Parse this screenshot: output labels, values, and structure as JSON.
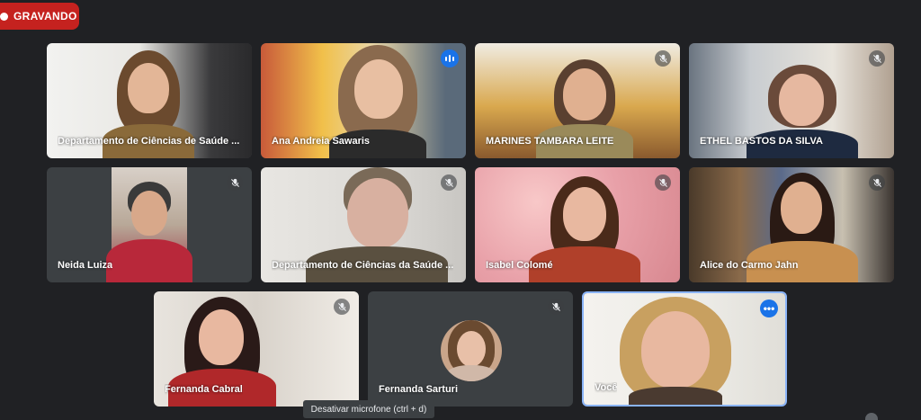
{
  "recording": {
    "label": "GRAVANDO",
    "color": "#c5221f"
  },
  "participants": [
    {
      "name": "Departamento de Ciências de Saúde ...",
      "status": "muted-hidden"
    },
    {
      "name": "Ana Andreia Sawaris",
      "status": "speaking"
    },
    {
      "name": "MARINES TAMBARA LEITE",
      "status": "muted"
    },
    {
      "name": "ETHEL BASTOS DA SILVA",
      "status": "muted"
    },
    {
      "name": "Neida Luiza",
      "status": "muted"
    },
    {
      "name": "Departamento de Ciências da Saúde ...",
      "status": "muted"
    },
    {
      "name": "Isabel Colomé",
      "status": "muted"
    },
    {
      "name": "Alice do Carmo Jahn",
      "status": "muted"
    },
    {
      "name": "Fernanda Cabral",
      "status": "muted"
    },
    {
      "name": "Fernanda Sarturi",
      "status": "muted"
    },
    {
      "name": "Você",
      "status": "self"
    }
  ],
  "tooltip": "Desativar microfone (ctrl + d)",
  "icons": {
    "mic_off": "mic-off-icon",
    "speaking": "audio-levels-icon",
    "more": "more-options-icon"
  },
  "accent": "#1a73e8"
}
